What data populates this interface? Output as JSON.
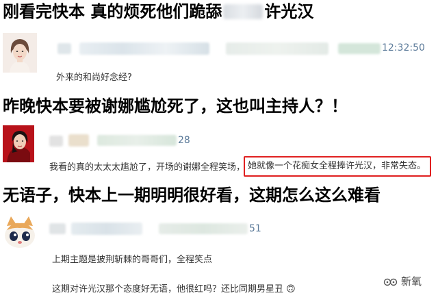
{
  "headings": {
    "h1": "刚看完快本 真的烦死他们跪舔",
    "h1_tail": "许光汉",
    "h2": "昨晚快本要被谢娜尴尬死了，这也叫主持人？！",
    "h3": "无语子，快本上一期明明很好看，这期怎么这么难看"
  },
  "comments": [
    {
      "meta_time": "12:32:50",
      "text": "外来的和尚好念经?"
    },
    {
      "meta_num": "28",
      "text_before": "我看的真的太太太尴尬了，开场的谢娜全程笑场，",
      "text_highlight": "她就像一个花痴女全程捧许光汉，非常失态。"
    },
    {
      "meta_num": "51",
      "line1": "上期主题是披荆斩棘的哥哥们，全程笑点",
      "line2": "这期对许光汉那个态度好无语，他很红吗？还比同期男星丑",
      "emoji": "🙃"
    }
  ],
  "watermark": {
    "label": "新氧",
    "icon": "logo-icon"
  },
  "colors": {
    "highlight_border": "#e02020",
    "meta_blue": "#5b7a99"
  }
}
